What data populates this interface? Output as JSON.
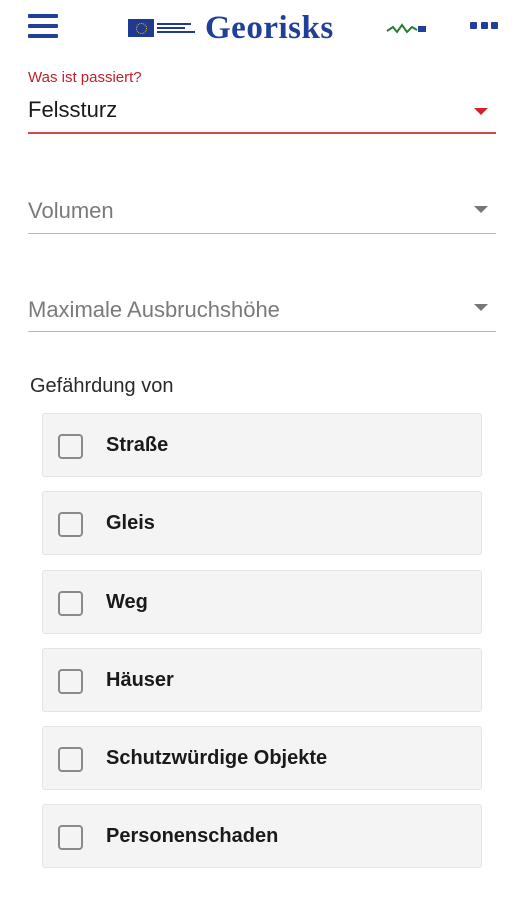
{
  "header": {
    "brand": "Georisks",
    "icons": {
      "menu": "hamburger-menu-icon",
      "more": "more-options-icon"
    }
  },
  "incident": {
    "label": "Was ist passiert?",
    "value": "Felssturz"
  },
  "volume": {
    "placeholder": "Volumen"
  },
  "height": {
    "placeholder": "Maximale Ausbruchshöhe"
  },
  "hazard": {
    "label": "Gefährdung von",
    "options": [
      {
        "label": "Straße",
        "checked": false
      },
      {
        "label": "Gleis",
        "checked": false
      },
      {
        "label": "Weg",
        "checked": false
      },
      {
        "label": "Häuser",
        "checked": false
      },
      {
        "label": "Schutzwürdige Objekte",
        "checked": false
      },
      {
        "label": "Personenschaden",
        "checked": false
      }
    ]
  },
  "colors": {
    "brand": "#1f3f9a",
    "accent": "#c0212a",
    "divider": "#b8b8b8"
  }
}
